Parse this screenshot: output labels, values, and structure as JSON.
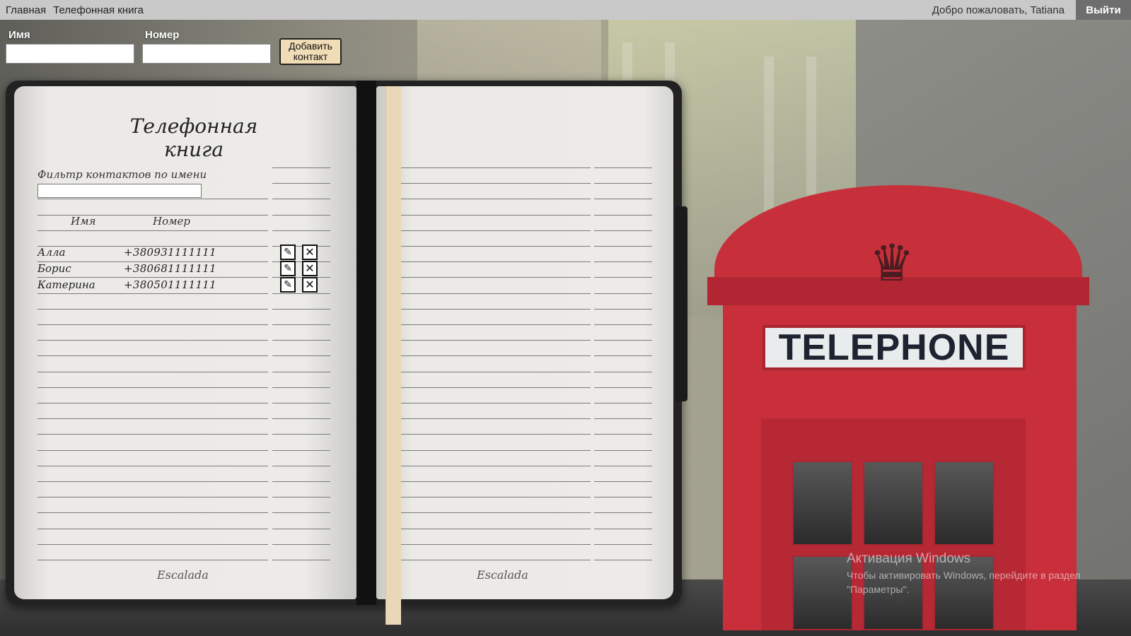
{
  "nav": {
    "home": "Главная",
    "phonebook": "Телефонная книга",
    "welcome": "Добро пожаловать, Tatiana",
    "logout": "Выйти"
  },
  "add_form": {
    "name_label": "Имя",
    "number_label": "Номер",
    "name_value": "",
    "number_value": "",
    "add_button_line1": "Добавить",
    "add_button_line2": "контакт"
  },
  "notebook": {
    "title": "Телефонная книга",
    "filter_label": "Фильтр контактов по имени",
    "filter_value": "",
    "col_name": "Имя",
    "col_number": "Номер",
    "brand_left": "Escalada",
    "brand_right": "Escalada",
    "contacts": [
      {
        "name": "Алла",
        "phone": "+380931111111"
      },
      {
        "name": "Борис",
        "phone": "+380681111111"
      },
      {
        "name": "Катерина",
        "phone": "+380501111111"
      }
    ]
  },
  "background": {
    "booth_sign": "TELEPHONE",
    "booth_color": "#c92f3b"
  },
  "watermark": {
    "title": "Активация Windows",
    "text": "Чтобы активировать Windows, перейдите в раздел \"Параметры\"."
  },
  "icons": {
    "edit": "pencil-icon",
    "delete": "close-icon",
    "crown": "crown-icon"
  }
}
